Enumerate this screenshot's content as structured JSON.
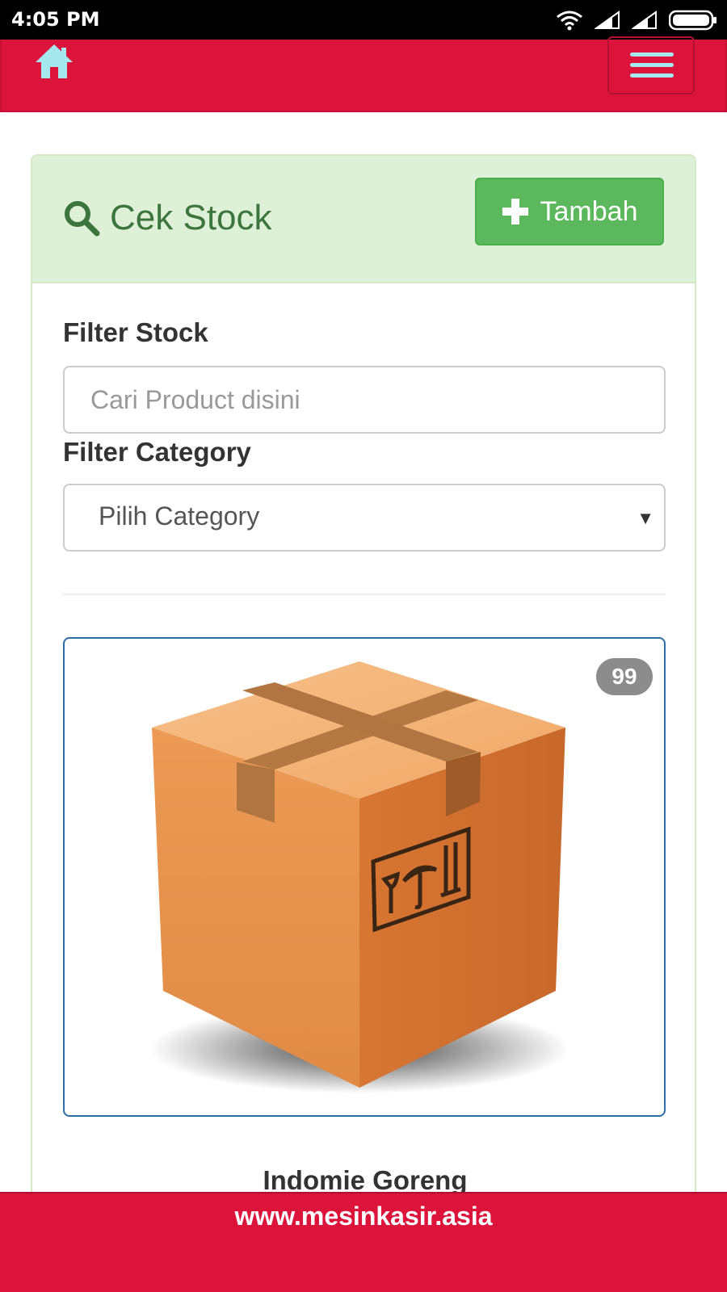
{
  "status_bar": {
    "time": "4:05 PM"
  },
  "nav": {
    "home_icon": "home-icon",
    "menu_icon": "hamburger-menu-icon"
  },
  "panel": {
    "title": "Cek Stock",
    "add_label": "Tambah",
    "filter_stock_label": "Filter Stock",
    "search_placeholder": "Cari Product disini",
    "filter_category_label": "Filter Category",
    "category_selected": "Pilih Category"
  },
  "products": [
    {
      "name": "Indomie Goreng",
      "stock": "99",
      "image": "cardboard-box-icon"
    }
  ],
  "footer": {
    "link": "www.mesinkasir.asia"
  },
  "colors": {
    "brand": "#dc143c",
    "success": "#5cb85c",
    "panel_header": "#dff0d8",
    "title_green": "#3c763d",
    "menu_bars": "#a5e8ee"
  }
}
